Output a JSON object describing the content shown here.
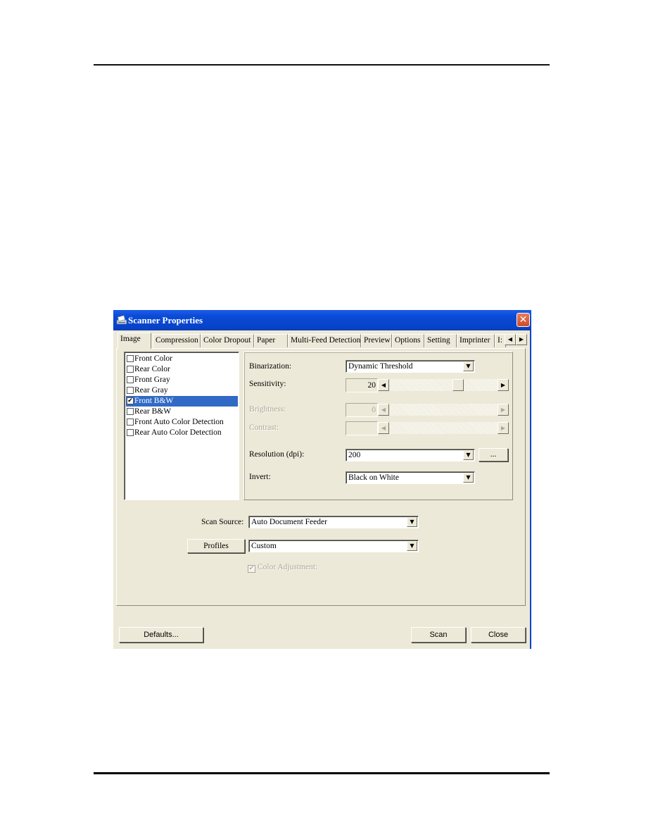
{
  "document": {
    "header_rule": true,
    "footer_rule": true
  },
  "dialog": {
    "title": "Scanner Properties",
    "icon": "scanner-icon",
    "close_glyph": "✕",
    "tabs": [
      {
        "label": "Image",
        "active": true
      },
      {
        "label": "Compression",
        "active": false
      },
      {
        "label": "Color Dropout",
        "active": false
      },
      {
        "label": "Paper",
        "active": false
      },
      {
        "label": "Multi-Feed Detection",
        "active": false
      },
      {
        "label": "Preview",
        "active": false
      },
      {
        "label": "Options",
        "active": false
      },
      {
        "label": "Setting",
        "active": false
      },
      {
        "label": "Imprinter",
        "active": false
      },
      {
        "label": "I:",
        "active": false
      }
    ],
    "tab_scroll": {
      "left": "◀",
      "right": "▶"
    },
    "image_types": [
      {
        "label": "Front Color",
        "checked": false,
        "selected": false
      },
      {
        "label": "Rear Color",
        "checked": false,
        "selected": false
      },
      {
        "label": "Front Gray",
        "checked": false,
        "selected": false
      },
      {
        "label": "Rear Gray",
        "checked": false,
        "selected": false
      },
      {
        "label": "Front B&W",
        "checked": true,
        "selected": true
      },
      {
        "label": "Rear B&W",
        "checked": false,
        "selected": false
      },
      {
        "label": "Front Auto Color Detection",
        "checked": false,
        "selected": false
      },
      {
        "label": "Rear Auto Color Detection",
        "checked": false,
        "selected": false
      }
    ],
    "settings": {
      "binarization": {
        "label": "Binarization:",
        "value": "Dynamic Threshold"
      },
      "sensitivity": {
        "label": "Sensitivity:",
        "value": "20",
        "slider_fraction": 0.65
      },
      "brightness": {
        "label": "Brightness:",
        "value": "0",
        "disabled": true
      },
      "contrast": {
        "label": "Contrast:",
        "value": "",
        "disabled": true
      },
      "resolution": {
        "label": "Resolution (dpi):",
        "value": "200",
        "more_button": "..."
      },
      "invert": {
        "label": "Invert:",
        "value": "Black on White"
      }
    },
    "scan_source": {
      "label": "Scan Source:",
      "value": "Auto Document Feeder"
    },
    "profiles": {
      "button_label": "Profiles",
      "value": "Custom"
    },
    "color_adjustment": {
      "label": "Color Adjustment:",
      "checked": true,
      "disabled": true
    },
    "buttons": {
      "defaults": "Defaults...",
      "scan": "Scan",
      "close": "Close"
    },
    "glyphs": {
      "dropdown": "▼",
      "left": "◀",
      "right": "▶",
      "check": "✔"
    }
  }
}
